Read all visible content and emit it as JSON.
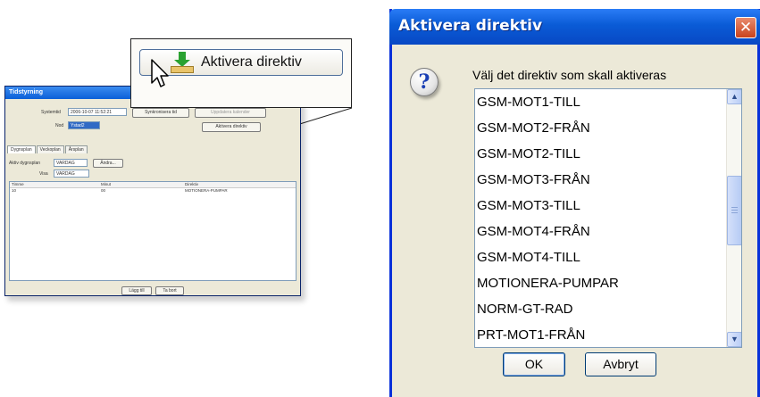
{
  "mini_window": {
    "title": "Tidstyrning",
    "systemtid_label": "Systemtid",
    "systemtid_value": "2006-10-07 11:52:21",
    "sync_button": "Synkronisera tid",
    "uppdatera_button": "Uppdatera kalender",
    "nod_label": "Nod",
    "nod_value": "Ystad2",
    "aktivera_button": "Aktivera direktiv",
    "tabs": [
      "Dygnsplan",
      "Veckoplan",
      "Årsplan"
    ],
    "aktiv_label": "Aktiv dygnsplan",
    "aktiv_value": "VARDAG",
    "andra_button": "Ändra...",
    "visa_label": "Visa",
    "visa_value": "VARDAG",
    "columns": [
      "Timme",
      "Minut",
      "Direktiv"
    ],
    "rows": [
      {
        "timme": "10",
        "minut": "00",
        "direktiv": "MOTIONERA-PUMPAR"
      }
    ],
    "laggtill_button": "Lägg till",
    "tabort_button": "Ta bort"
  },
  "callout": {
    "button_label": "Aktivera direktiv"
  },
  "dialog": {
    "title": "Aktivera direktiv",
    "close_symbol": "✕",
    "prompt": "Välj det direktiv som skall aktiveras",
    "items": [
      "GSM-MOT1-TILL",
      "GSM-MOT2-FRÅN",
      "GSM-MOT2-TILL",
      "GSM-MOT3-FRÅN",
      "GSM-MOT3-TILL",
      "GSM-MOT4-FRÅN",
      "GSM-MOT4-TILL",
      "MOTIONERA-PUMPAR",
      "NORM-GT-RAD",
      "PRT-MOT1-FRÅN"
    ],
    "ok_label": "OK",
    "cancel_label": "Avbryt"
  },
  "icons": {
    "question": "?",
    "scroll_up": "▲",
    "scroll_down": "▼"
  },
  "colors": {
    "titlebar": "#0a5bd6",
    "window_bg": "#ece9d8",
    "close": "#c9431d"
  }
}
